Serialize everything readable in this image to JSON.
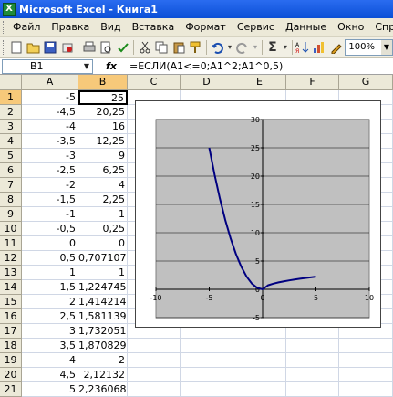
{
  "window": {
    "title": "Microsoft Excel - Книга1",
    "app_icon": "excel-icon"
  },
  "menu": [
    {
      "label": "Файл"
    },
    {
      "label": "Правка"
    },
    {
      "label": "Вид"
    },
    {
      "label": "Вставка"
    },
    {
      "label": "Формат"
    },
    {
      "label": "Сервис"
    },
    {
      "label": "Данные"
    },
    {
      "label": "Окно"
    },
    {
      "label": "Справ"
    }
  ],
  "toolbar": {
    "zoom": "100%",
    "sum_icon": "Σ"
  },
  "formula_bar": {
    "name_box": "B1",
    "fx": "fx",
    "formula": "=ЕСЛИ(A1<=0;A1^2;A1^0,5)"
  },
  "columns": [
    "A",
    "B",
    "C",
    "D",
    "E",
    "F",
    "G"
  ],
  "rows": [
    {
      "num": "1",
      "a": "-5",
      "b": "25"
    },
    {
      "num": "2",
      "a": "-4,5",
      "b": "20,25"
    },
    {
      "num": "3",
      "a": "-4",
      "b": "16"
    },
    {
      "num": "4",
      "a": "-3,5",
      "b": "12,25"
    },
    {
      "num": "5",
      "a": "-3",
      "b": "9"
    },
    {
      "num": "6",
      "a": "-2,5",
      "b": "6,25"
    },
    {
      "num": "7",
      "a": "-2",
      "b": "4"
    },
    {
      "num": "8",
      "a": "-1,5",
      "b": "2,25"
    },
    {
      "num": "9",
      "a": "-1",
      "b": "1"
    },
    {
      "num": "10",
      "a": "-0,5",
      "b": "0,25"
    },
    {
      "num": "11",
      "a": "0",
      "b": "0"
    },
    {
      "num": "12",
      "a": "0,5",
      "b": "0,707107"
    },
    {
      "num": "13",
      "a": "1",
      "b": "1"
    },
    {
      "num": "14",
      "a": "1,5",
      "b": "1,224745"
    },
    {
      "num": "15",
      "a": "2",
      "b": "1,414214"
    },
    {
      "num": "16",
      "a": "2,5",
      "b": "1,581139"
    },
    {
      "num": "17",
      "a": "3",
      "b": "1,732051"
    },
    {
      "num": "18",
      "a": "3,5",
      "b": "1,870829"
    },
    {
      "num": "19",
      "a": "4",
      "b": "2"
    },
    {
      "num": "20",
      "a": "4,5",
      "b": "2,12132"
    },
    {
      "num": "21",
      "a": "5",
      "b": "2,236068"
    }
  ],
  "chart_data": {
    "type": "line",
    "x": [
      -5,
      -4.5,
      -4,
      -3.5,
      -3,
      -2.5,
      -2,
      -1.5,
      -1,
      -0.5,
      0,
      0.5,
      1,
      1.5,
      2,
      2.5,
      3,
      3.5,
      4,
      4.5,
      5
    ],
    "series": [
      {
        "values": [
          25,
          20.25,
          16,
          12.25,
          9,
          6.25,
          4,
          2.25,
          1,
          0.25,
          0,
          0.707107,
          1,
          1.224745,
          1.414214,
          1.581139,
          1.732051,
          1.870829,
          2,
          2.12132,
          2.236068
        ],
        "color": "#000080"
      }
    ],
    "xlim": [
      -10,
      10
    ],
    "ylim": [
      -5,
      30
    ],
    "x_ticks": [
      "-10",
      "-5",
      "0",
      "5",
      "10"
    ],
    "y_ticks": [
      "-5",
      "0",
      "5",
      "10",
      "15",
      "20",
      "25",
      "30"
    ],
    "grid": true,
    "plot_background": "#c0c0c0",
    "legend": "none"
  }
}
